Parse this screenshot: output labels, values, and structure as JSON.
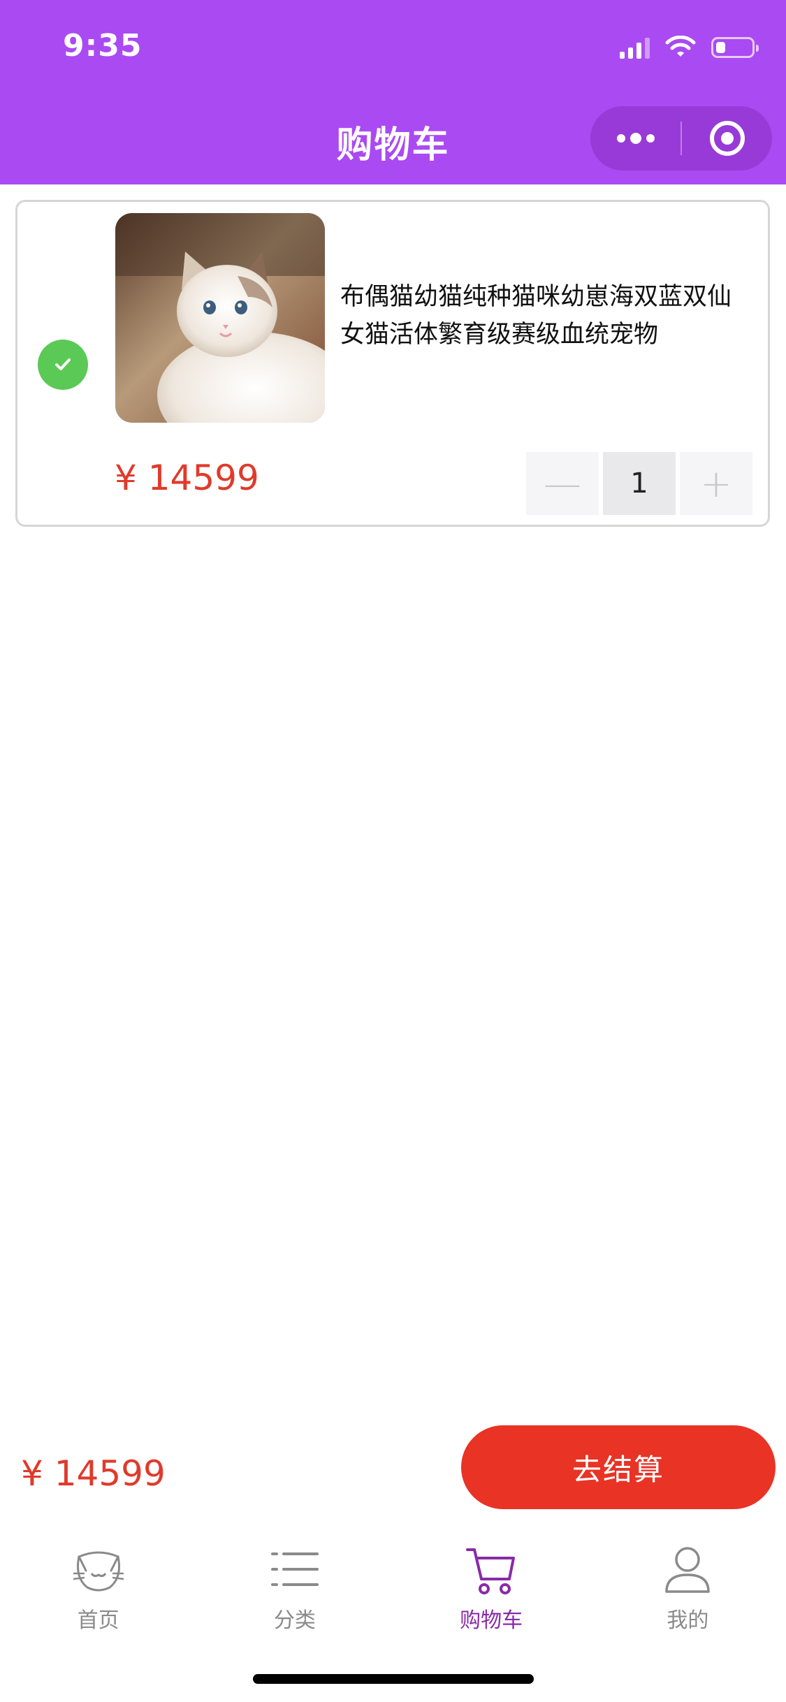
{
  "status_bar": {
    "time": "9:35",
    "battery_level": 0.25
  },
  "header": {
    "title": "购物车",
    "more_icon": "more-dots-icon",
    "close_icon": "target-circle-icon",
    "background_color": "#aa4af2"
  },
  "cart": {
    "items": [
      {
        "name": "布偶猫幼猫纯种猫咪幼崽海双蓝双仙女猫活体繁育级赛级血统宠物",
        "price": "¥ 14599",
        "quantity": "1",
        "selected": true,
        "decrement_symbol": "—",
        "increment_symbol": "+"
      }
    ]
  },
  "summary": {
    "total": "¥ 14599",
    "checkout_label": "去结算",
    "checkout_color": "#e83325",
    "price_color": "#e03a2b"
  },
  "tabbar": {
    "tabs": [
      {
        "label": "首页",
        "icon": "cat-face-icon",
        "active": false
      },
      {
        "label": "分类",
        "icon": "list-icon",
        "active": false
      },
      {
        "label": "购物车",
        "icon": "shopping-cart-icon",
        "active": true
      },
      {
        "label": "我的",
        "icon": "user-icon",
        "active": false
      }
    ],
    "active_color": "#8a2aa8",
    "inactive_color": "#8a8a8a"
  }
}
